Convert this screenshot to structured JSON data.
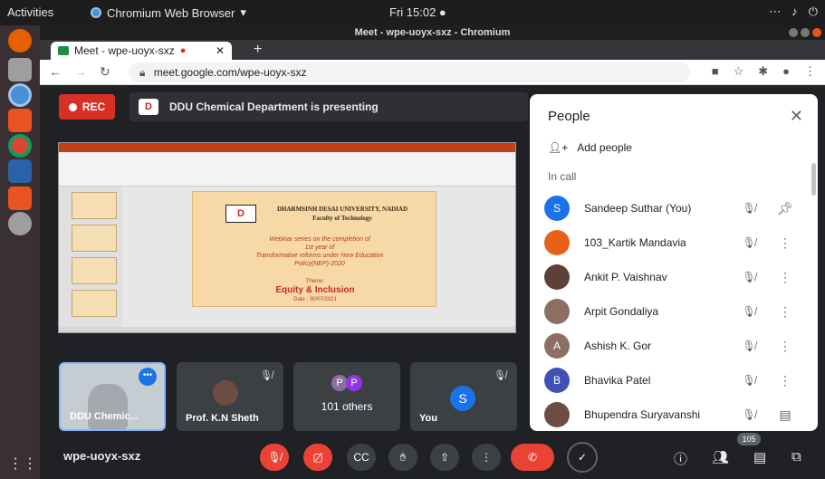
{
  "os": {
    "activities": "Activities",
    "app_name": "Chromium Web Browser",
    "app_menu_arrow": "▾",
    "clock": "Fri 15:02 ●",
    "tray": [
      "network-icon",
      "volume-icon",
      "power-icon"
    ]
  },
  "window": {
    "title": "Meet - wpe-uoyx-sxz - Chromium"
  },
  "browser": {
    "tab_title": "Meet - wpe-uoyx-sxz",
    "new_tab": "+",
    "url": "meet.google.com/wpe-uoyx-sxz"
  },
  "meet": {
    "rec_label": "REC",
    "presenting_text": "DDU Chemical Department is presenting",
    "slide": {
      "university": "DHARMSINH DESAI UNIVERSITY, NADIAD",
      "faculty": "Faculty of Technology",
      "line1": "Webinar series on the completion of",
      "line2": "1st year of",
      "line3": "Transformative reforms under New Education",
      "line4": "Policy(NEP)-2020",
      "theme_label": "Theme:",
      "theme": "Equity & Inclusion",
      "date": "Date : 30/07/2021"
    },
    "tiles": [
      {
        "name": "DDU Chemic...",
        "type": "self-view"
      },
      {
        "name": "Prof. K.N Sheth",
        "type": "video"
      },
      {
        "name": "101 others",
        "avatars": [
          "P",
          "P"
        ]
      },
      {
        "name": "You",
        "avatar": "S"
      }
    ]
  },
  "people_panel": {
    "title": "People",
    "add_people": "Add people",
    "section": "In call",
    "participants": [
      {
        "name": "Sandeep Suthar (You)",
        "initial": "S",
        "color": "#1a73e8",
        "action": "pin-icon"
      },
      {
        "name": "103_Kartik Mandavia",
        "initial": "",
        "color": "#e8611a",
        "action": "more-icon"
      },
      {
        "name": "Ankit P. Vaishnav",
        "initial": "",
        "color": "#5d4037",
        "action": "more-icon"
      },
      {
        "name": "Arpit Gondaliya",
        "initial": "",
        "color": "#8d6e63",
        "action": "more-icon"
      },
      {
        "name": "Ashish K. Gor",
        "initial": "A",
        "color": "#8d6e63",
        "action": "more-icon"
      },
      {
        "name": "Bhavika Patel",
        "initial": "B",
        "color": "#3f51b5",
        "action": "more-icon"
      },
      {
        "name": "Bhupendra Suryavanshi",
        "initial": "",
        "color": "#6d4c41",
        "action": "message-icon"
      }
    ]
  },
  "bottom_bar": {
    "meeting_code": "wpe-uoyx-sxz",
    "participant_count": "105"
  },
  "colors": {
    "meet_bg": "#202124",
    "rec_red": "#d93025",
    "accent_blue": "#1a73e8",
    "end_call_red": "#ea4335"
  }
}
